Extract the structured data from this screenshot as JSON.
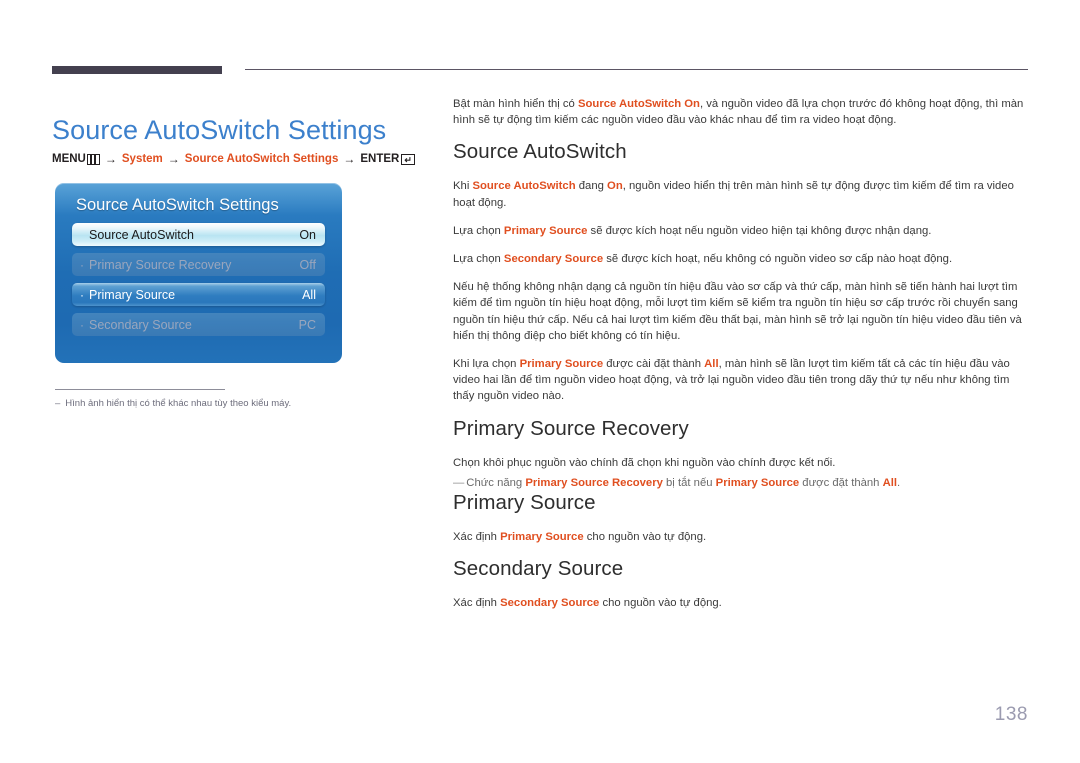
{
  "page_title": "Source AutoSwitch Settings",
  "breadcrumb": {
    "menu_label": "MENU",
    "menu_icon": "menu-bars-icon",
    "arrow": "→",
    "step1": "System",
    "step2": "Source AutoSwitch Settings",
    "enter_label": "ENTER",
    "enter_icon": "enter-return-icon"
  },
  "osd": {
    "title": "Source AutoSwitch Settings",
    "rows": [
      {
        "label": "Source AutoSwitch",
        "value": "On",
        "state": "selected",
        "bullet": ""
      },
      {
        "label": "Primary Source Recovery",
        "value": "Off",
        "state": "disabled",
        "bullet": "·"
      },
      {
        "label": "Primary Source",
        "value": "All",
        "state": "active",
        "bullet": "·"
      },
      {
        "label": "Secondary Source",
        "value": "PC",
        "state": "disabled",
        "bullet": "·"
      }
    ]
  },
  "footnote": {
    "dash": "–",
    "text": "Hình ảnh hiển thị có thể khác nhau tùy theo kiểu máy."
  },
  "intro": {
    "a": "Bật màn hình hiển thị có ",
    "hl": "Source AutoSwitch On",
    "b": ", và nguồn video đã lựa chọn trước đó không hoạt động, thì màn hình sẽ tự động tìm kiếm các nguồn video đầu vào khác nhau để tìm ra video hoạt động."
  },
  "sections": [
    {
      "heading": "Source AutoSwitch",
      "paragraphs": [
        {
          "a": "Khi ",
          "hl": "Source AutoSwitch",
          "b": " đang ",
          "hl2": "On",
          "c": ", nguồn video hiển thị trên màn hình sẽ tự động được tìm kiếm để tìm ra video hoạt động."
        },
        {
          "a": "Lựa chọn ",
          "hl": "Primary Source",
          "b": " sẽ được kích hoạt nếu nguồn video hiện tại không được nhận dạng."
        },
        {
          "a": "Lựa chọn ",
          "hl": "Secondary Source",
          "b": " sẽ được kích hoạt, nếu không có nguồn video sơ cấp nào hoạt động."
        },
        {
          "a": "Nếu hệ thống không nhận dạng cả nguồn tín hiệu đầu vào sơ cấp và thứ cấp, màn hình sẽ tiến hành hai lượt tìm kiếm để tìm nguồn tín hiệu hoạt động, mỗi lượt tìm kiếm sẽ kiểm tra nguồn tín hiệu sơ cấp trước rồi chuyển sang nguồn tín hiệu thứ cấp. Nếu cả hai lượt tìm kiếm đều thất bại, màn hình sẽ trở lại nguồn tín hiệu video đầu tiên và hiển thị thông điệp cho biết không có tín hiệu."
        },
        {
          "a": "Khi lựa chọn ",
          "hl": "Primary Source",
          "b": " được cài đặt thành ",
          "hl2": "All",
          "c": ", màn hình sẽ lần lượt tìm kiếm tất cả các tín hiệu đầu vào video hai lần để tìm nguồn video hoạt động, và trở lại nguồn video đầu tiên trong dãy thứ tự nếu như không tìm thấy nguồn video nào."
        }
      ]
    },
    {
      "heading": "Primary Source Recovery",
      "body": "Chọn khôi phục nguồn vào chính đã chọn khi nguồn vào chính được kết nối.",
      "note": {
        "dash": "—",
        "a": "Chức năng ",
        "hl": "Primary Source Recovery",
        "b": " bị tắt nếu ",
        "hl2": "Primary Source",
        "c": " được đặt thành ",
        "hl3": "All",
        "d": "."
      }
    },
    {
      "heading": "Primary Source",
      "body_a": "Xác định ",
      "body_hl": "Primary Source",
      "body_b": " cho nguồn vào tự động."
    },
    {
      "heading": "Secondary Source",
      "body_a": "Xác định ",
      "body_hl": "Secondary Source",
      "body_b": " cho nguồn vào tự động."
    }
  ],
  "page_number": "138",
  "colors": {
    "title_blue": "#3c80cc",
    "accent_orange": "#e04f20",
    "osd_blue": "#1f6db4",
    "rule_dark": "#44404f",
    "page_number_gray": "#9b9bb0"
  }
}
